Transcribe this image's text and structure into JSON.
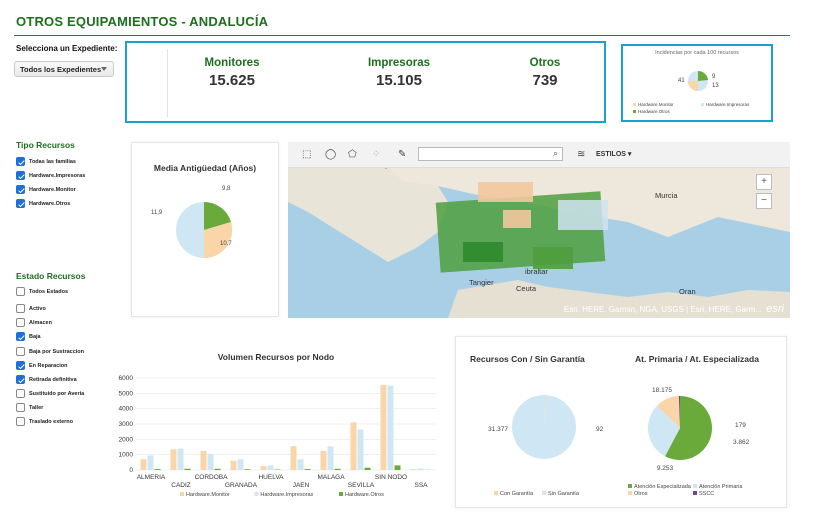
{
  "header": {
    "title": "OTROS EQUIPAMIENTOS  -  ANDALUCÍA"
  },
  "expediente": {
    "label": "Selecciona un Expediente:",
    "selected": "Todos los Expedientes"
  },
  "kpis": [
    {
      "label": "Monitores",
      "value": "15.625"
    },
    {
      "label": "Impresoras",
      "value": "15.105"
    },
    {
      "label": "Otros",
      "value": "739"
    }
  ],
  "incidencias": {
    "title": "Incidencias por cada 100 recursos",
    "labels": [
      "41",
      "9",
      "13"
    ],
    "legend": [
      "Hardware.Monitor",
      "Hardware.Impresoras",
      "Hardware.Otros"
    ]
  },
  "tipo_recursos": {
    "title": "Tipo Recursos",
    "items": [
      {
        "label": "Todas las familias",
        "checked": true
      },
      {
        "label": "Hardware.Impresoras",
        "checked": true
      },
      {
        "label": "Hardware.Monitor",
        "checked": true
      },
      {
        "label": "Hardware.Otros",
        "checked": true
      }
    ]
  },
  "estado_recursos": {
    "title": "Estado Recursos",
    "items": [
      {
        "label": "Todos Estados",
        "checked": false
      },
      {
        "label": "Activo",
        "checked": false
      },
      {
        "label": "Almacen",
        "checked": false
      },
      {
        "label": "Baja",
        "checked": true
      },
      {
        "label": "Baja por Sustraccion",
        "checked": false
      },
      {
        "label": "En Reparacion",
        "checked": true
      },
      {
        "label": "Retirada definitiva",
        "checked": true
      },
      {
        "label": "Sustituido por Averia",
        "checked": false
      },
      {
        "label": "Taller",
        "checked": false
      },
      {
        "label": "Traslado externo",
        "checked": false
      }
    ]
  },
  "antiguedad": {
    "title": "Media Antigüedad (Años)",
    "labels": [
      "9,8",
      "11,9",
      "10,7"
    ]
  },
  "map": {
    "estilos": "ESTILOS",
    "labels": {
      "murcia": "Murcia",
      "gibraltar": "ibraltar",
      "tangier": "Tangier",
      "ceuta": "Ceuta",
      "oran": "Oran"
    },
    "attribution": "Esri, HERE, Garmin, NGA, USGS | Esri, HERE, Garm...",
    "logo": "esri",
    "zoom_in": "+",
    "zoom_out": "−"
  },
  "chart_data": [
    {
      "type": "bar",
      "title": "Volumen Recursos por Nodo",
      "categories": [
        "ALMERIA",
        "CADIZ",
        "CORDOBA",
        "GRANADA",
        "HUELVA",
        "JAEN",
        "MALAGA",
        "SEVILLA",
        "SIN NODO",
        "SSA"
      ],
      "series": [
        {
          "name": "Hardware.Monitor",
          "color": "#f9d5a7",
          "values": [
            700,
            1350,
            1250,
            600,
            250,
            1550,
            1250,
            3100,
            5550,
            50
          ]
        },
        {
          "name": "Hardware.Impresoras",
          "color": "#cfe6f5",
          "values": [
            950,
            1400,
            1050,
            700,
            300,
            700,
            1550,
            2650,
            5500,
            100
          ]
        },
        {
          "name": "Hardware.Otros",
          "color": "#6aaa3a",
          "values": [
            60,
            80,
            80,
            50,
            30,
            60,
            80,
            150,
            300,
            10
          ]
        }
      ],
      "yticks": [
        "0",
        "1000",
        "2000",
        "3000",
        "4000",
        "5000",
        "6000"
      ],
      "ylim": [
        0,
        6000
      ]
    },
    {
      "type": "pie",
      "title": "Recursos Con / Sin Garantía",
      "labels": [
        "Con Garantía",
        "Sin Garantía"
      ],
      "values": [
        92,
        31377
      ],
      "colors": [
        "#f9d5a7",
        "#cfe6f5"
      ],
      "value_labels": [
        "92",
        "31.377"
      ]
    },
    {
      "type": "pie",
      "title": "At. Primaria / At. Especializada",
      "labels": [
        "Atención Especializada",
        "Atención Primaria",
        "Otros",
        "SSCC"
      ],
      "values": [
        18175,
        9253,
        3862,
        179
      ],
      "colors": [
        "#6aaa3a",
        "#cfe6f5",
        "#f9d5a7",
        "#7a3fa0"
      ],
      "value_labels": [
        "18.175",
        "9.253",
        "3.862",
        "179"
      ]
    }
  ]
}
